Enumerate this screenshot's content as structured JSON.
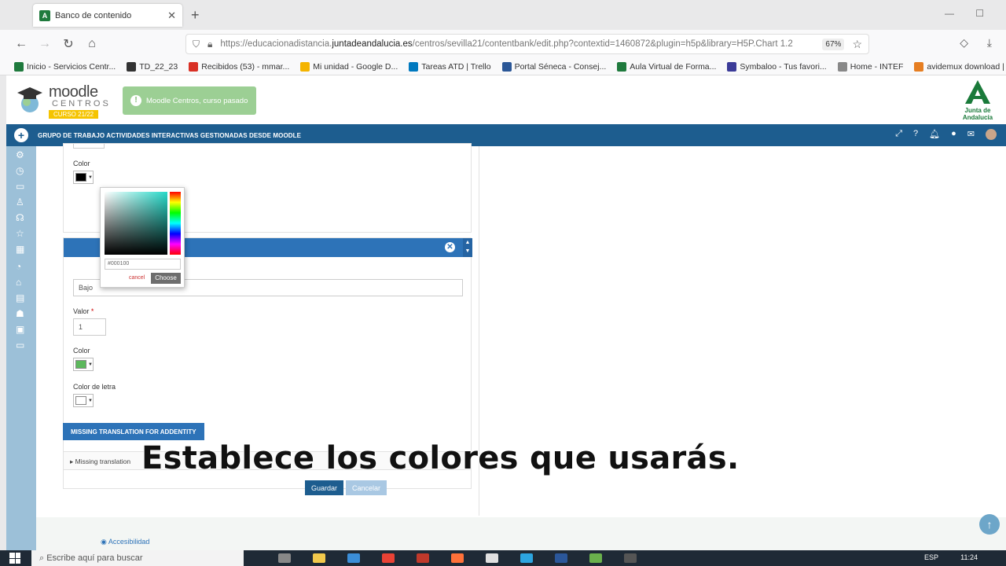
{
  "browser": {
    "tab_title": "Banco de contenido",
    "url_prefix": "https://educacionadistancia.",
    "url_domain": "juntadeandalucia.es",
    "url_path": "/centros/sevilla21/contentbank/edit.php?contextid=1460872&plugin=h5p&library=H5P.Chart 1.2",
    "zoom": "67%",
    "bookmarks": [
      {
        "label": "Inicio - Servicios Centr...",
        "color": "#1f7a3d"
      },
      {
        "label": "TD_22_23",
        "color": "#333333"
      },
      {
        "label": "Recibidos (53) - mmar...",
        "color": "#d93025"
      },
      {
        "label": "Mi unidad - Google D...",
        "color": "#f4b400"
      },
      {
        "label": "Tareas ATD | Trello",
        "color": "#0079bf"
      },
      {
        "label": "Portal Séneca - Consej...",
        "color": "#2b5797"
      },
      {
        "label": "Aula Virtual de Forma...",
        "color": "#1f7a3d"
      },
      {
        "label": "Symbaloo - Tus favori...",
        "color": "#3b3b98"
      },
      {
        "label": "Home - INTEF",
        "color": "#888888"
      },
      {
        "label": "avidemux download | ...",
        "color": "#e67e22"
      }
    ]
  },
  "site": {
    "logo_word": "moodle",
    "logo_sub": "CENTROS",
    "logo_year": "CURSO 21/22",
    "notice": "Moodle Centros, curso pasado",
    "junta": "Junta de Andalucía",
    "course_title": "GRUPO DE TRABAJO ACTIVIDADES INTERACTIVAS GESTIONADAS DESDE MOODLE"
  },
  "form": {
    "color_label": "Color",
    "picker": {
      "hex_value": "#000100",
      "cancel": "cancel",
      "choose": "Choose",
      "selected_color": "#000000"
    },
    "text_value": "Bajo",
    "valor_label": "Valor",
    "valor_value": "1",
    "color2_label": "Color",
    "color2_value": "#5cb85c",
    "font_color_label": "Color de letra",
    "font_color_value": "#ffffff",
    "add_button": "MISSING TRANSLATION FOR ADDENTITY",
    "collapsed_label": "Missing translation",
    "save_button": "Guardar",
    "cancel_button": "Cancelar"
  },
  "footer": {
    "accessibility": "Accesibilidad"
  },
  "subtitle": "Establece los colores que usarás.",
  "taskbar": {
    "search_placeholder": "Escribe aquí para buscar",
    "lang": "ESP",
    "time": "11:24"
  }
}
